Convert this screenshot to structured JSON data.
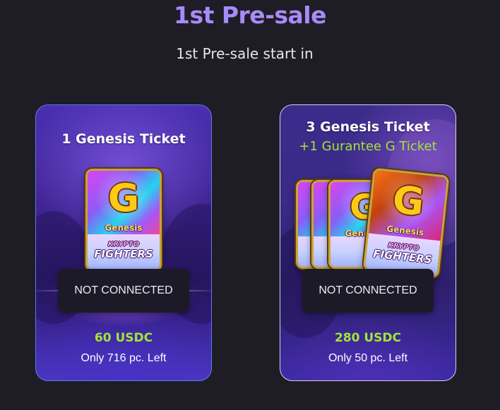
{
  "header": {
    "title": "1st Pre-sale",
    "subtitle": "1st Pre-sale start in"
  },
  "ticket_art": {
    "letter": "G",
    "name": "Genesis",
    "logo_line1": "KRYPTO",
    "logo_line2": "FIGHTERS"
  },
  "cards": [
    {
      "heading": "1 Genesis Ticket",
      "button_label": "NOT CONNECTED",
      "price": "60 USDC",
      "remaining": "Only 716 pc. Left"
    },
    {
      "heading": "3 Genesis Ticket",
      "bonus": "+1 Gurantee G Ticket",
      "button_label": "NOT CONNECTED",
      "price": "280 USDC",
      "remaining": "Only 50 pc. Left"
    }
  ],
  "colors": {
    "accent_title": "#a78bfa",
    "price_green": "#a3e635",
    "background": "#1e1d25"
  }
}
